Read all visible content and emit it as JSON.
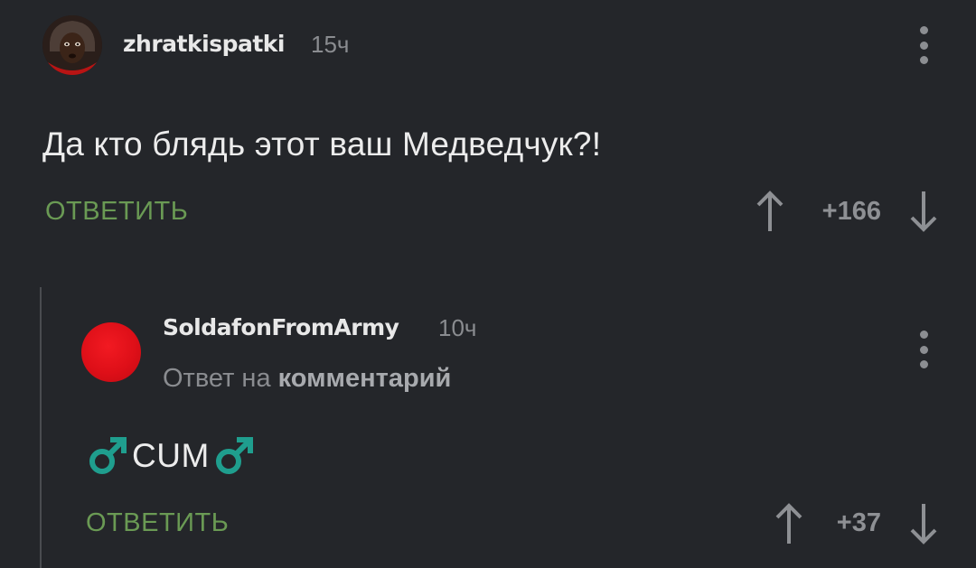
{
  "comment": {
    "author": "zhratkispatki",
    "time": "15ч",
    "text": "Да кто блядь этот ваш Медведчук?!",
    "reply_label": "ОТВЕТИТЬ",
    "rating": "+166"
  },
  "reply": {
    "author": "SoldafonFromArmy",
    "time": "10ч",
    "reply_to_prefix": "Ответ на",
    "reply_to_link": "комментарий",
    "text": "CUM",
    "reply_label": "ОТВЕТИТЬ",
    "rating": "+37"
  },
  "colors": {
    "background": "#24262a",
    "reply_green": "#6a9a54",
    "avatar_red": "#de0f18",
    "male_symbol_teal": "#1f9e8e"
  },
  "icons": [
    "more-vert-icon",
    "arrow-up-icon",
    "arrow-down-icon",
    "male-sign-icon"
  ]
}
